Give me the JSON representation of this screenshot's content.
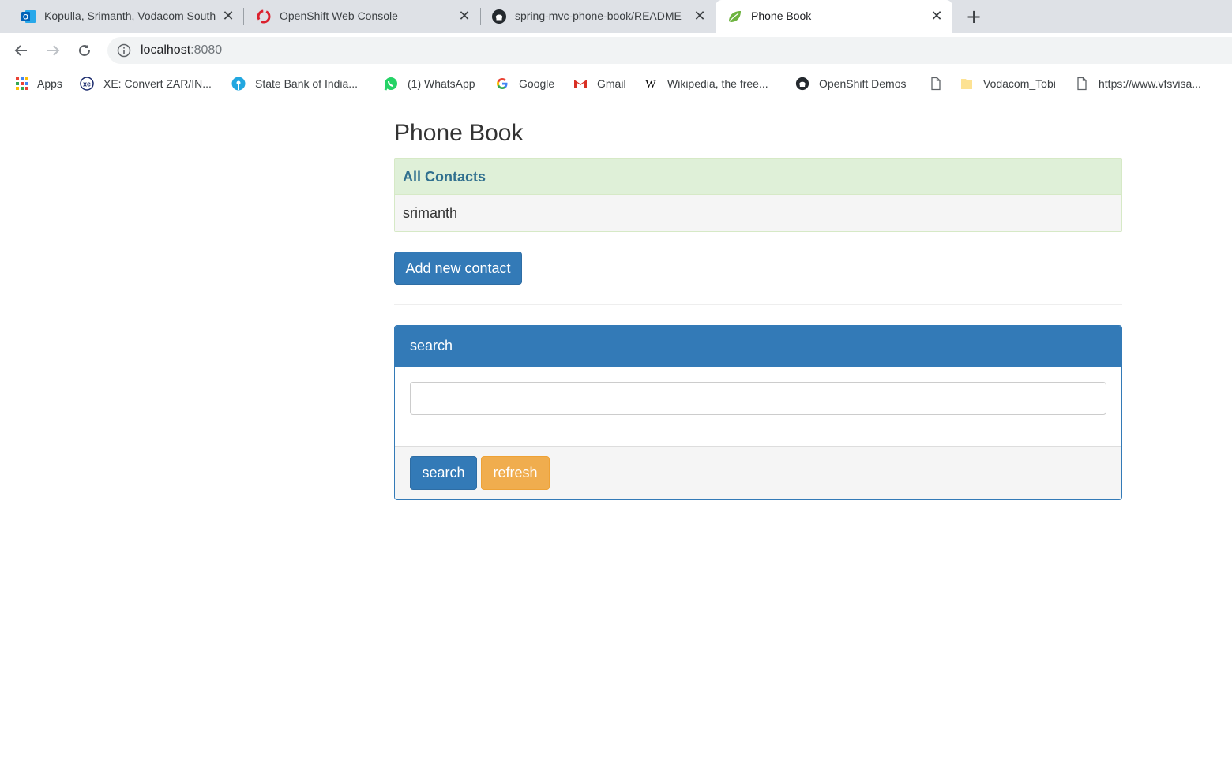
{
  "browser": {
    "tabs": [
      {
        "title": "Kopulla, Srimanth, Vodacom South",
        "icon": "outlook-icon",
        "active": false
      },
      {
        "title": "OpenShift Web Console",
        "icon": "openshift-icon",
        "active": false
      },
      {
        "title": "spring-mvc-phone-book/README",
        "icon": "github-icon",
        "active": false
      },
      {
        "title": "Phone Book",
        "icon": "spring-leaf-icon",
        "active": true
      }
    ],
    "address": {
      "host": "localhost",
      "port": ":8080"
    },
    "bookmarks": [
      {
        "label": "Apps",
        "icon": "apps-grid-icon"
      },
      {
        "label": "XE: Convert ZAR/IN...",
        "icon": "xe-icon"
      },
      {
        "label": "State Bank of India...",
        "icon": "sbi-icon"
      },
      {
        "label": "(1) WhatsApp",
        "icon": "whatsapp-icon"
      },
      {
        "label": "Google",
        "icon": "google-icon"
      },
      {
        "label": "Gmail",
        "icon": "gmail-icon"
      },
      {
        "label": "Wikipedia, the free...",
        "icon": "wikipedia-icon"
      },
      {
        "label": "OpenShift Demos",
        "icon": "github-icon"
      },
      {
        "label": "",
        "icon": "page-icon"
      },
      {
        "label": "Vodacom_Tobi",
        "icon": "folder-icon"
      },
      {
        "label": "https://www.vfsvisa...",
        "icon": "page-icon"
      }
    ]
  },
  "page": {
    "title": "Phone Book",
    "contacts": {
      "heading": "All Contacts",
      "items": [
        "srimanth"
      ]
    },
    "add_button": "Add new contact",
    "search": {
      "heading": "search",
      "input_value": "",
      "search_button": "search",
      "refresh_button": "refresh"
    }
  },
  "colors": {
    "primary": "#337ab7",
    "warning": "#f0ad4e",
    "success_bg": "#dff0d8",
    "info_text": "#31708f"
  }
}
